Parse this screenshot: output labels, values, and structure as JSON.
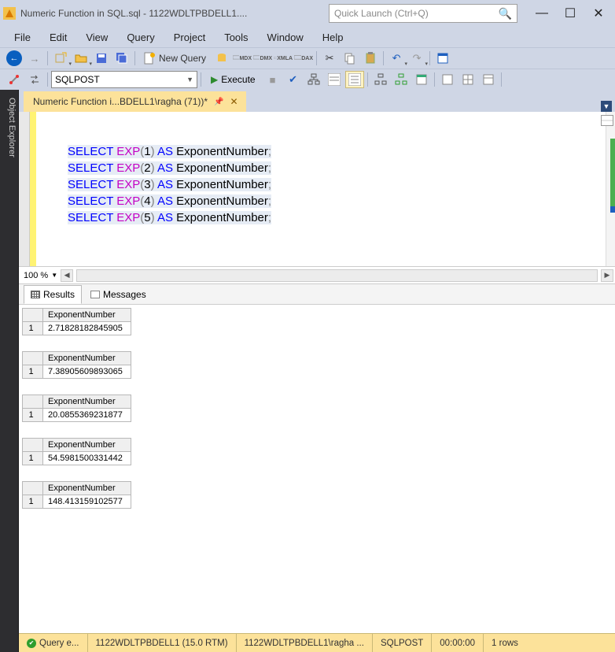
{
  "title": "Numeric Function in SQL.sql - 1122WDLTPBDELL1....",
  "quick_launch_placeholder": "Quick Launch (Ctrl+Q)",
  "menu": [
    "File",
    "Edit",
    "View",
    "Query",
    "Project",
    "Tools",
    "Window",
    "Help"
  ],
  "toolbar": {
    "new_query": "New Query",
    "execute": "Execute",
    "db_selected": "SQLPOST"
  },
  "doc_tab": "Numeric Function i...BDELL1\\ragha (71))*",
  "side_tab": "Object Explorer",
  "zoom": "100 %",
  "code_lines": [
    {
      "arg": "1"
    },
    {
      "arg": "2"
    },
    {
      "arg": "3"
    },
    {
      "arg": "4"
    },
    {
      "arg": "5"
    }
  ],
  "code_tokens": {
    "select": "SELECT",
    "exp": "EXP",
    "as": "AS",
    "alias": "ExponentNumber"
  },
  "result_tabs": {
    "results": "Results",
    "messages": "Messages"
  },
  "results": [
    {
      "header": "ExponentNumber",
      "row": "1",
      "value": "2.71828182845905"
    },
    {
      "header": "ExponentNumber",
      "row": "1",
      "value": "7.38905609893065"
    },
    {
      "header": "ExponentNumber",
      "row": "1",
      "value": "20.0855369231877"
    },
    {
      "header": "ExponentNumber",
      "row": "1",
      "value": "54.5981500331442"
    },
    {
      "header": "ExponentNumber",
      "row": "1",
      "value": "148.413159102577"
    }
  ],
  "status": {
    "query": "Query e...",
    "server": "1122WDLTPBDELL1 (15.0 RTM)",
    "user": "1122WDLTPBDELL1\\ragha ...",
    "db": "SQLPOST",
    "time": "00:00:00",
    "rows": "1 rows"
  }
}
